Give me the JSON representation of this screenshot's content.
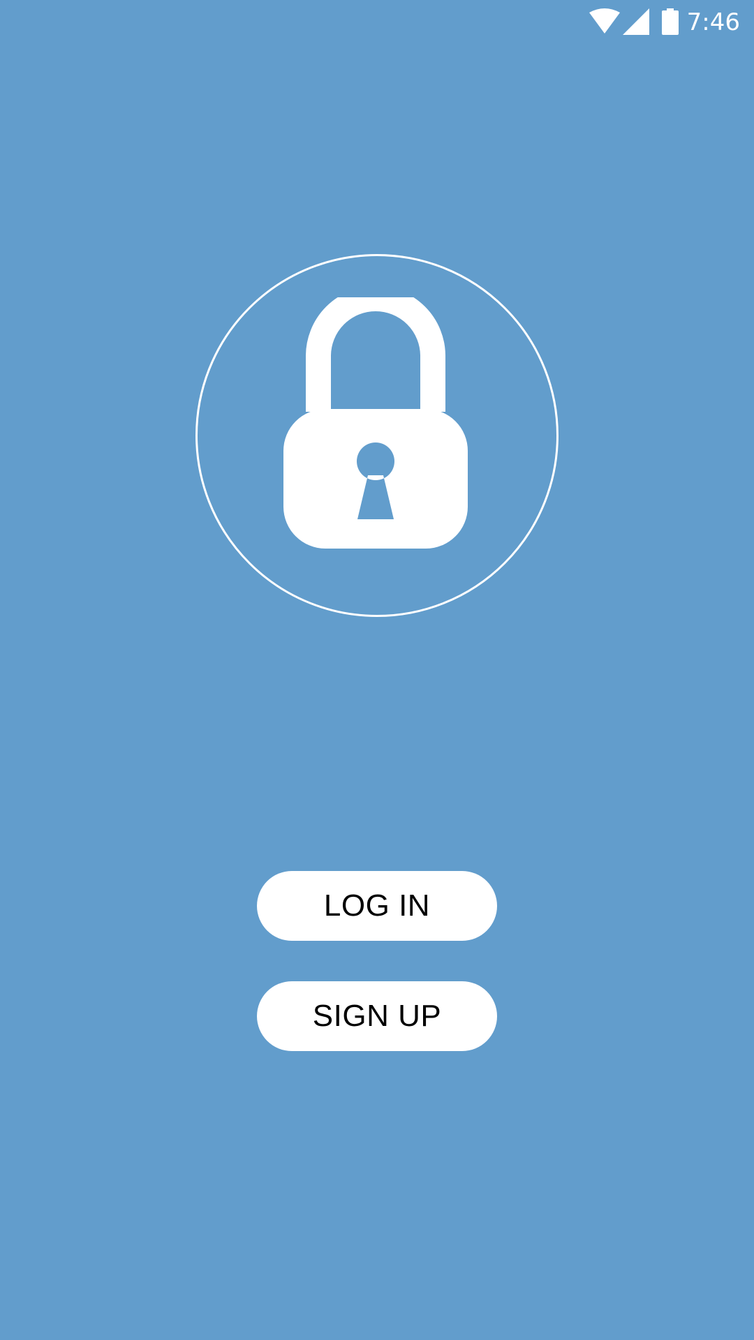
{
  "status_bar": {
    "time": "7:46",
    "icons": [
      "wifi-icon",
      "cellular-signal-icon",
      "battery-icon"
    ]
  },
  "hero": {
    "icon": "padlock-icon"
  },
  "actions": {
    "login_label": "LOG IN",
    "signup_label": "SIGN UP"
  },
  "colors": {
    "background": "#629dcc",
    "foreground": "#ffffff",
    "button_text": "#000000"
  }
}
